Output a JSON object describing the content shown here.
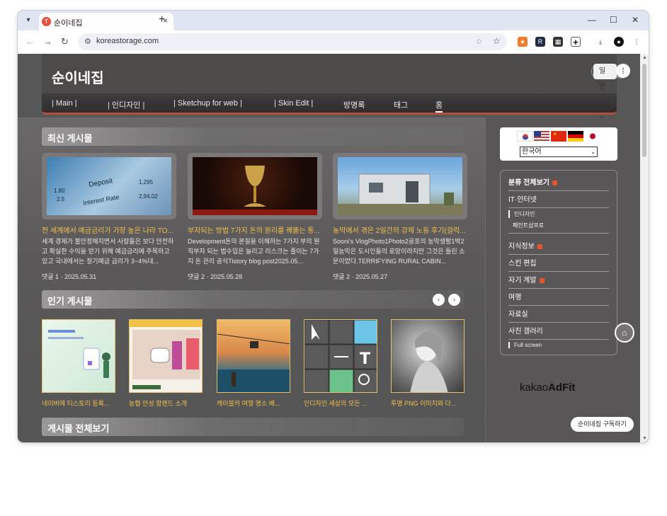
{
  "browser": {
    "tab_title": "순이네집",
    "tab_favicon": "T",
    "url": "koreastorage.com",
    "new_tab": "+",
    "close_tab": "×",
    "window_controls": [
      "—",
      "☐",
      "✕"
    ]
  },
  "site": {
    "title": "순이네집",
    "mode_tooltip": "일반 모드"
  },
  "nav": {
    "items": [
      "| Main |",
      "| 인디자인 |",
      "| Sketchup for web |",
      "| Skin Edit |",
      "방명록",
      "태그",
      "홈"
    ],
    "active": "홈"
  },
  "latest": {
    "title": "최신 게시물",
    "posts": [
      {
        "title": "전 세계에서 예금금리가 가장 높은 나라 TO...",
        "excerpt": "세계 경제가 불안정해지면서 사람들은 보다 안전하고 확실한 수익을 얻기 위해 예금금리에 주목하고 있고 국내에서는 정기예금 금리가 3~4%대...",
        "meta": "댓글 1  ·  2025.05.31"
      },
      {
        "title": "부자되는 방법 7가지 돈의 원리를 꿰뚫는 통...",
        "excerpt": "Development돈의 본질을 이해하는 7가지 부의 원칙부자 되는 법수입은 늘리고 리스크는 줄이는 7가지 돈 관리 공식Tistory blog post2025.05...",
        "meta": "댓글 2  ·  2025.05.28"
      },
      {
        "title": "농막에서 겪은 2일간의 강제 노동 후기(걸럭...",
        "excerpt": "Sooni's VlogPhoto1Photo2공포의 농막생활1박2일농막은 도시인들의 로망이라지만 그것은 틀린 소문이었다.TERRIFYING RURAL CABIN...",
        "meta": "댓글 2  ·  2025.05.27"
      }
    ]
  },
  "popular": {
    "title": "인기 게시물",
    "prev": "‹",
    "next": "›",
    "posts": [
      "네이버에 티스토리 등록...",
      "농협 안성 팜랜드 소개",
      "케이블카 여행 명소 베...",
      "인디자인 세상의 모든 ...",
      "투명 PNG 이미지와 다..."
    ]
  },
  "all_posts": {
    "title": "게시물 전체보기"
  },
  "sidebar": {
    "language": "한국어",
    "categories": {
      "title": "분류 전체보기",
      "items": [
        {
          "label": "IT·인터넷"
        },
        {
          "label": "인디자인",
          "sub": true
        },
        {
          "label": "페인트샵프로",
          "sub": true
        },
        {
          "label": "지식정보"
        },
        {
          "label": "스킨 편집"
        },
        {
          "label": "자기 계발"
        },
        {
          "label": "여행"
        },
        {
          "label": "자료실"
        },
        {
          "label": "사진 갤러리"
        },
        {
          "label": "Full screen",
          "sub": true
        }
      ]
    },
    "ad": {
      "prefix": "kakao",
      "brand": "AdFit"
    },
    "subscribe": "순이네집 구독하기"
  }
}
